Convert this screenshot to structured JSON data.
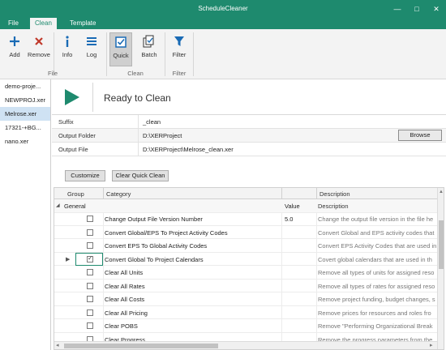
{
  "window": {
    "title": "ScheduleCleaner",
    "minimize": "—",
    "maximize": "□",
    "close": "✕"
  },
  "menu": {
    "file": "File",
    "clean": "Clean",
    "template": "Template"
  },
  "ribbon": {
    "add": "Add",
    "remove": "Remove",
    "info": "Info",
    "log": "Log",
    "quick": "Quick",
    "batch": "Batch",
    "filter": "Filter",
    "group_file": "File",
    "group_clean": "Clean",
    "group_filter": "Filter"
  },
  "sidebar": {
    "items": [
      {
        "label": "demo-proje..."
      },
      {
        "label": "NEWPROJ.xer"
      },
      {
        "label": "Melrose.xer"
      },
      {
        "label": "17321-+BG..."
      },
      {
        "label": "nano.xer"
      }
    ]
  },
  "status": {
    "text": "Ready to Clean"
  },
  "props": {
    "suffix_label": "Suffix",
    "suffix_value": "_clean",
    "folder_label": "Output Folder",
    "folder_value": "D:\\XERProject",
    "browse_label": "Browse",
    "file_label": "Output File",
    "file_value": "D:\\XERProject\\Melrose_clean.xer"
  },
  "actions": {
    "customize": "Customize",
    "clear_quick_clean": "Clear Quick Clean"
  },
  "grid": {
    "headers": {
      "group": "Group",
      "category": "Category",
      "value": "Value",
      "description": "Description"
    },
    "group_name": "General",
    "rows": [
      {
        "category": "Change Output File Version Number",
        "value": "5.0",
        "description": "Change the output file version in the file he"
      },
      {
        "category": "Convert Global/EPS To Project Activity Codes",
        "value": "",
        "description": "Convert Global and EPS activity codes that"
      },
      {
        "category": "Convert EPS To Global Activity Codes",
        "value": "",
        "description": "Convert EPS Activity Codes that are used in"
      },
      {
        "category": "Convert Global To Project Calendars",
        "value": "",
        "description": "Covert global calendars that are used in th"
      },
      {
        "category": "Clear All Units",
        "value": "",
        "description": "Remove all types of units for assigned reso"
      },
      {
        "category": "Clear All Rates",
        "value": "",
        "description": "Remove all types of rates for assigned reso"
      },
      {
        "category": "Clear All Costs",
        "value": "",
        "description": "Remove project funding, budget changes, s"
      },
      {
        "category": "Clear All Pricing",
        "value": "",
        "description": "Remove prices for resources and roles fro"
      },
      {
        "category": "Clear POBS",
        "value": "",
        "description": "Remove \"Performing Organizational Break"
      },
      {
        "category": "Clear Progress",
        "value": "",
        "description": "Remove the progress parameters from the"
      }
    ]
  }
}
